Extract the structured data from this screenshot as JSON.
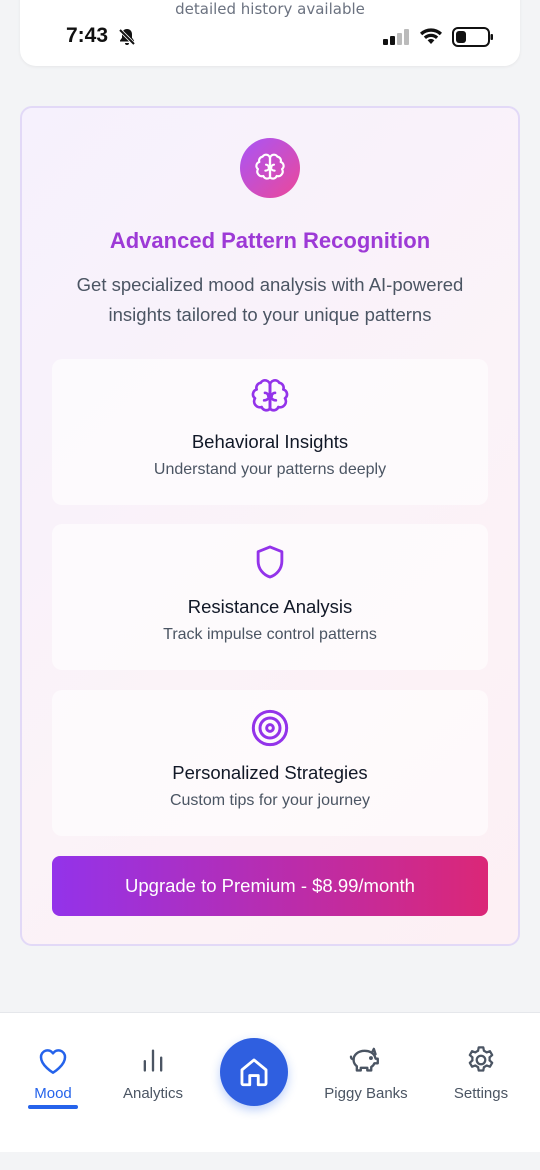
{
  "status_bar": {
    "time": "7:43"
  },
  "top_card": {
    "history_text": "detailed history available"
  },
  "premium": {
    "title": "Advanced Pattern Recognition",
    "description": "Get specialized mood analysis with AI-powered insights tailored to your unique patterns",
    "features": [
      {
        "title": "Behavioral Insights",
        "description": "Understand your patterns deeply",
        "icon": "brain-icon"
      },
      {
        "title": "Resistance Analysis",
        "description": "Track impulse control patterns",
        "icon": "shield-icon"
      },
      {
        "title": "Personalized Strategies",
        "description": "Custom tips for your journey",
        "icon": "target-icon"
      }
    ],
    "upgrade_label": "Upgrade to Premium - $8.99/month"
  },
  "nav": {
    "items": [
      {
        "label": "Mood",
        "icon": "heart-icon",
        "active": true
      },
      {
        "label": "Analytics",
        "icon": "bar-chart-icon"
      },
      {
        "label": "Piggy Banks",
        "icon": "piggy-bank-icon"
      },
      {
        "label": "Settings",
        "icon": "gear-icon"
      }
    ],
    "home_icon": "home-icon"
  },
  "colors": {
    "accent_purple": "#9d3ad6",
    "gradient_start": "#9333ea",
    "gradient_end": "#db2777",
    "nav_active": "#2563eb"
  }
}
